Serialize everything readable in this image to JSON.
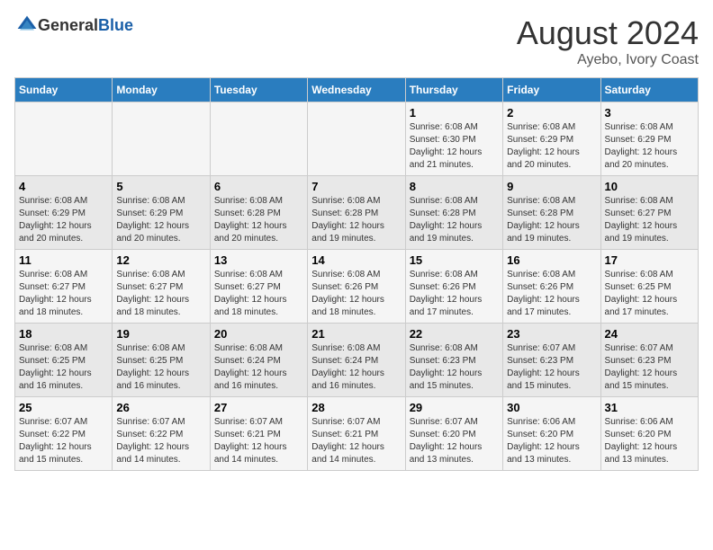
{
  "header": {
    "logo_general": "General",
    "logo_blue": "Blue",
    "title": "August 2024",
    "subtitle": "Ayebo, Ivory Coast"
  },
  "weekdays": [
    "Sunday",
    "Monday",
    "Tuesday",
    "Wednesday",
    "Thursday",
    "Friday",
    "Saturday"
  ],
  "weeks": [
    [
      {
        "day": "",
        "info": ""
      },
      {
        "day": "",
        "info": ""
      },
      {
        "day": "",
        "info": ""
      },
      {
        "day": "",
        "info": ""
      },
      {
        "day": "1",
        "info": "Sunrise: 6:08 AM\nSunset: 6:30 PM\nDaylight: 12 hours and 21 minutes."
      },
      {
        "day": "2",
        "info": "Sunrise: 6:08 AM\nSunset: 6:29 PM\nDaylight: 12 hours and 20 minutes."
      },
      {
        "day": "3",
        "info": "Sunrise: 6:08 AM\nSunset: 6:29 PM\nDaylight: 12 hours and 20 minutes."
      }
    ],
    [
      {
        "day": "4",
        "info": "Sunrise: 6:08 AM\nSunset: 6:29 PM\nDaylight: 12 hours and 20 minutes."
      },
      {
        "day": "5",
        "info": "Sunrise: 6:08 AM\nSunset: 6:29 PM\nDaylight: 12 hours and 20 minutes."
      },
      {
        "day": "6",
        "info": "Sunrise: 6:08 AM\nSunset: 6:28 PM\nDaylight: 12 hours and 20 minutes."
      },
      {
        "day": "7",
        "info": "Sunrise: 6:08 AM\nSunset: 6:28 PM\nDaylight: 12 hours and 19 minutes."
      },
      {
        "day": "8",
        "info": "Sunrise: 6:08 AM\nSunset: 6:28 PM\nDaylight: 12 hours and 19 minutes."
      },
      {
        "day": "9",
        "info": "Sunrise: 6:08 AM\nSunset: 6:28 PM\nDaylight: 12 hours and 19 minutes."
      },
      {
        "day": "10",
        "info": "Sunrise: 6:08 AM\nSunset: 6:27 PM\nDaylight: 12 hours and 19 minutes."
      }
    ],
    [
      {
        "day": "11",
        "info": "Sunrise: 6:08 AM\nSunset: 6:27 PM\nDaylight: 12 hours and 18 minutes."
      },
      {
        "day": "12",
        "info": "Sunrise: 6:08 AM\nSunset: 6:27 PM\nDaylight: 12 hours and 18 minutes."
      },
      {
        "day": "13",
        "info": "Sunrise: 6:08 AM\nSunset: 6:27 PM\nDaylight: 12 hours and 18 minutes."
      },
      {
        "day": "14",
        "info": "Sunrise: 6:08 AM\nSunset: 6:26 PM\nDaylight: 12 hours and 18 minutes."
      },
      {
        "day": "15",
        "info": "Sunrise: 6:08 AM\nSunset: 6:26 PM\nDaylight: 12 hours and 17 minutes."
      },
      {
        "day": "16",
        "info": "Sunrise: 6:08 AM\nSunset: 6:26 PM\nDaylight: 12 hours and 17 minutes."
      },
      {
        "day": "17",
        "info": "Sunrise: 6:08 AM\nSunset: 6:25 PM\nDaylight: 12 hours and 17 minutes."
      }
    ],
    [
      {
        "day": "18",
        "info": "Sunrise: 6:08 AM\nSunset: 6:25 PM\nDaylight: 12 hours and 16 minutes."
      },
      {
        "day": "19",
        "info": "Sunrise: 6:08 AM\nSunset: 6:25 PM\nDaylight: 12 hours and 16 minutes."
      },
      {
        "day": "20",
        "info": "Sunrise: 6:08 AM\nSunset: 6:24 PM\nDaylight: 12 hours and 16 minutes."
      },
      {
        "day": "21",
        "info": "Sunrise: 6:08 AM\nSunset: 6:24 PM\nDaylight: 12 hours and 16 minutes."
      },
      {
        "day": "22",
        "info": "Sunrise: 6:08 AM\nSunset: 6:23 PM\nDaylight: 12 hours and 15 minutes."
      },
      {
        "day": "23",
        "info": "Sunrise: 6:07 AM\nSunset: 6:23 PM\nDaylight: 12 hours and 15 minutes."
      },
      {
        "day": "24",
        "info": "Sunrise: 6:07 AM\nSunset: 6:23 PM\nDaylight: 12 hours and 15 minutes."
      }
    ],
    [
      {
        "day": "25",
        "info": "Sunrise: 6:07 AM\nSunset: 6:22 PM\nDaylight: 12 hours and 15 minutes."
      },
      {
        "day": "26",
        "info": "Sunrise: 6:07 AM\nSunset: 6:22 PM\nDaylight: 12 hours and 14 minutes."
      },
      {
        "day": "27",
        "info": "Sunrise: 6:07 AM\nSunset: 6:21 PM\nDaylight: 12 hours and 14 minutes."
      },
      {
        "day": "28",
        "info": "Sunrise: 6:07 AM\nSunset: 6:21 PM\nDaylight: 12 hours and 14 minutes."
      },
      {
        "day": "29",
        "info": "Sunrise: 6:07 AM\nSunset: 6:20 PM\nDaylight: 12 hours and 13 minutes."
      },
      {
        "day": "30",
        "info": "Sunrise: 6:06 AM\nSunset: 6:20 PM\nDaylight: 12 hours and 13 minutes."
      },
      {
        "day": "31",
        "info": "Sunrise: 6:06 AM\nSunset: 6:20 PM\nDaylight: 12 hours and 13 minutes."
      }
    ]
  ]
}
